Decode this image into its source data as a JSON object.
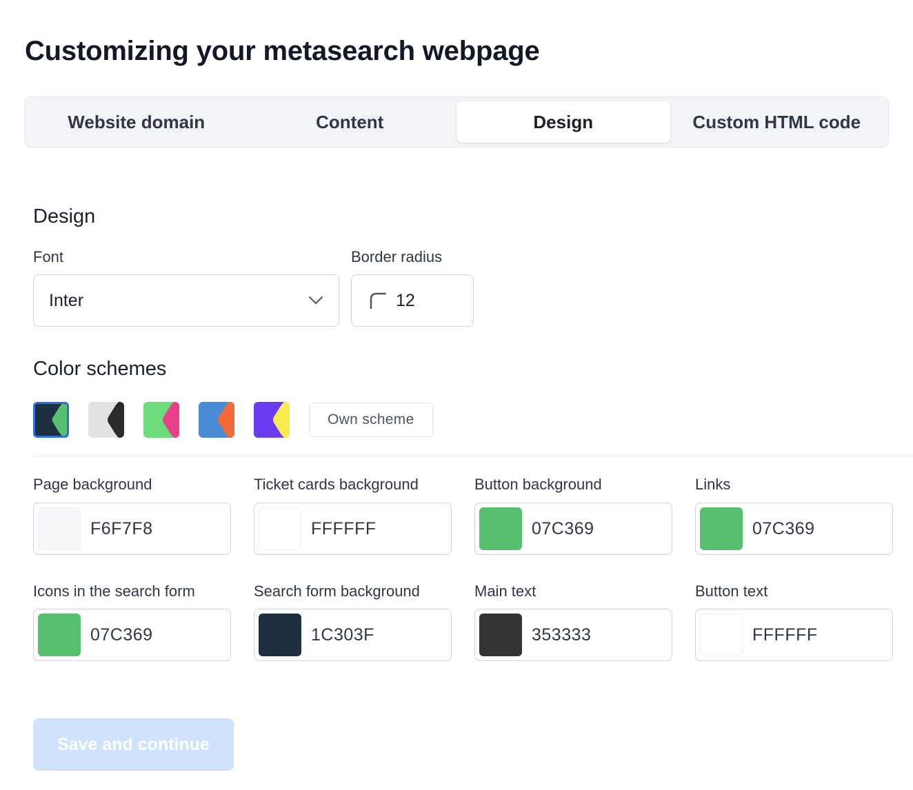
{
  "page": {
    "title": "Customizing your metasearch webpage"
  },
  "tabs": [
    {
      "label": "Website domain",
      "active": false
    },
    {
      "label": "Content",
      "active": false
    },
    {
      "label": "Design",
      "active": true
    },
    {
      "label": "Custom HTML code",
      "active": false
    }
  ],
  "design": {
    "heading": "Design",
    "font": {
      "label": "Font",
      "value": "Inter",
      "icon": "chevron-down-icon"
    },
    "border_radius": {
      "label": "Border radius",
      "value": "12",
      "icon": "corner-radius-icon"
    }
  },
  "color_schemes": {
    "heading": "Color schemes",
    "swatches": [
      {
        "background": "#1c303f",
        "accent": "#57c06e",
        "selected": true
      },
      {
        "background": "#e2e2e2",
        "accent": "#2b2b2b",
        "selected": false
      },
      {
        "background": "#6cdc7c",
        "accent": "#e8408a",
        "selected": false
      },
      {
        "background": "#4a8bd6",
        "accent": "#f2693a",
        "selected": false
      },
      {
        "background": "#6a3ef0",
        "accent": "#fce94f",
        "selected": false
      }
    ],
    "own_scheme_label": "Own scheme"
  },
  "colors": [
    {
      "label": "Page background",
      "value": "F6F7F8",
      "swatch": "#f6f7f8"
    },
    {
      "label": "Ticket cards background",
      "value": "FFFFFF",
      "swatch": "#ffffff"
    },
    {
      "label": "Button background",
      "value": "07C369",
      "swatch": "#57c06e"
    },
    {
      "label": "Links",
      "value": "07C369",
      "swatch": "#57c06e"
    },
    {
      "label": "Icons in the search form",
      "value": "07C369",
      "swatch": "#57c06e"
    },
    {
      "label": "Search form background",
      "value": "1C303F",
      "swatch": "#1f2f3f"
    },
    {
      "label": "Main text",
      "value": "353333",
      "swatch": "#353333"
    },
    {
      "label": "Button text",
      "value": "FFFFFF",
      "swatch": "#ffffff"
    }
  ],
  "save_button": {
    "label": "Save and continue",
    "disabled": true
  }
}
